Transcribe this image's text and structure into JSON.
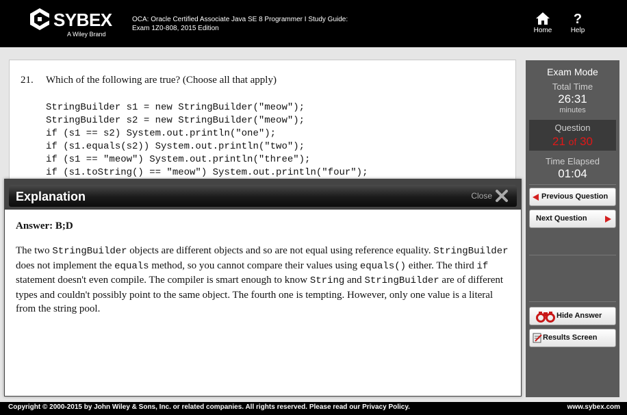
{
  "header": {
    "brand": "SYBEX",
    "brand_sub": "A Wiley Brand",
    "book_title_line1": "OCA: Oracle Certified Associate Java SE 8 Programmer I Study Guide:",
    "book_title_line2": "Exam 1Z0-808, 2015 Edition",
    "home_label": "Home",
    "help_label": "Help"
  },
  "question": {
    "number": "21.",
    "text": "Which of the following are true? (Choose all that apply)",
    "code": "StringBuilder s1 = new StringBuilder(\"meow\");\nStringBuilder s2 = new StringBuilder(\"meow\");\nif (s1 == s2) System.out.println(\"one\");\nif (s1.equals(s2)) System.out.println(\"two\");\nif (s1 == \"meow\") System.out.println(\"three\");\nif (s1.toString() == \"meow\") System.out.println(\"four\");"
  },
  "explanation": {
    "title": "Explanation",
    "close_label": "Close",
    "answer": "Answer: B;D",
    "segments": [
      {
        "t": "The two ",
        "mono": false
      },
      {
        "t": "StringBuilder",
        "mono": true
      },
      {
        "t": " objects are different objects and so are not equal using reference equality. ",
        "mono": false
      },
      {
        "t": "StringBuilder",
        "mono": true
      },
      {
        "t": " does not implement the ",
        "mono": false
      },
      {
        "t": "equals",
        "mono": true
      },
      {
        "t": " method, so you cannot compare their values using ",
        "mono": false
      },
      {
        "t": "equals()",
        "mono": true
      },
      {
        "t": " either. The third ",
        "mono": false
      },
      {
        "t": "if",
        "mono": true
      },
      {
        "t": " statement doesn't even compile. The compiler is smart enough to know ",
        "mono": false
      },
      {
        "t": "String",
        "mono": true
      },
      {
        "t": " and ",
        "mono": false
      },
      {
        "t": "StringBuilder",
        "mono": true
      },
      {
        "t": " are of different types and couldn't possibly point to the same object. The fourth one is tempting. However, only one value is a literal from the string pool.",
        "mono": false
      }
    ]
  },
  "sidebar": {
    "mode_title": "Exam Mode",
    "total_time_label": "Total Time",
    "total_time_value": "26:31",
    "total_time_unit": "minutes",
    "question_label": "Question",
    "question_current": "21",
    "question_of": "of",
    "question_total": "30",
    "elapsed_label": "Time Elapsed",
    "elapsed_value": "01:04",
    "prev_label": "Previous Question",
    "next_label": "Next Question",
    "hide_answer_label": "Hide Answer",
    "results_label": "Results Screen"
  },
  "footer": {
    "copyright": "Copyright © 2000-2015 by John Wiley & Sons, Inc. or related companies. All rights reserved. Please read our Privacy Policy.",
    "site": "www.sybex.com"
  },
  "colors": {
    "accent_red": "#d42020",
    "header_bg": "#000000",
    "sidebar_bg": "#5a5a5a"
  }
}
